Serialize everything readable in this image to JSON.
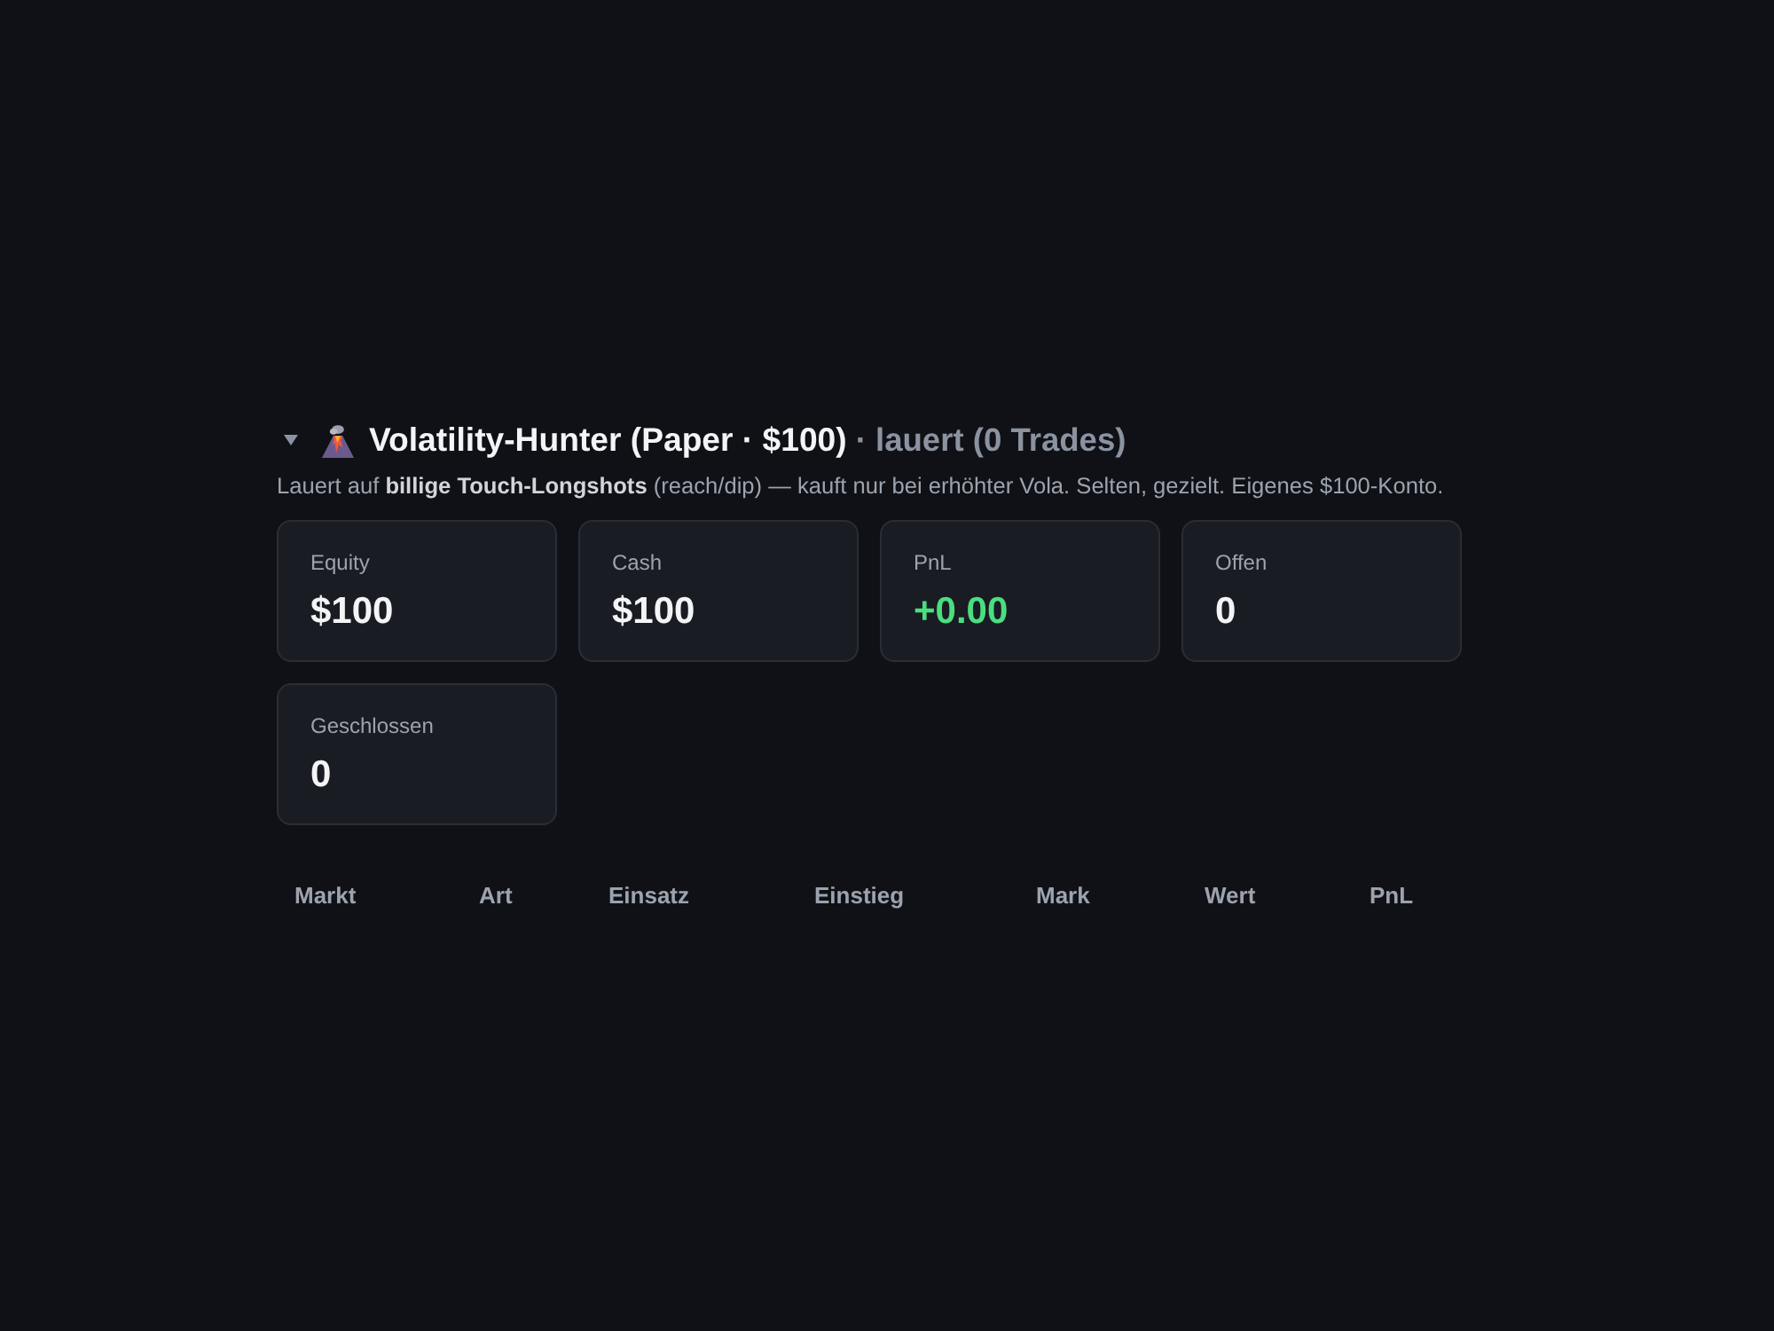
{
  "section": {
    "expanded": true,
    "title": "Volatility-Hunter (Paper · $100)",
    "status": "· lauert (0 Trades)",
    "description": "Lauert auf **billige Touch-Longshots** (reach/dip) — kauft nur bei erhöhter Vola. Selten, gezielt. Eigenes $100-Konto."
  },
  "stats": [
    {
      "label": "Equity",
      "value": "$100",
      "color": "#f3f4f6"
    },
    {
      "label": "Cash",
      "value": "$100",
      "color": "#f3f4f6"
    },
    {
      "label": "PnL",
      "value": "+0.00",
      "color": "#4ade80"
    },
    {
      "label": "Offen",
      "value": "0",
      "color": "#f3f4f6"
    },
    {
      "label": "Geschlossen",
      "value": "0",
      "color": "#f3f4f6"
    }
  ],
  "table": {
    "columns": [
      "Markt",
      "Art",
      "Einsatz",
      "Einstieg",
      "Mark",
      "Wert",
      "PnL"
    ]
  }
}
